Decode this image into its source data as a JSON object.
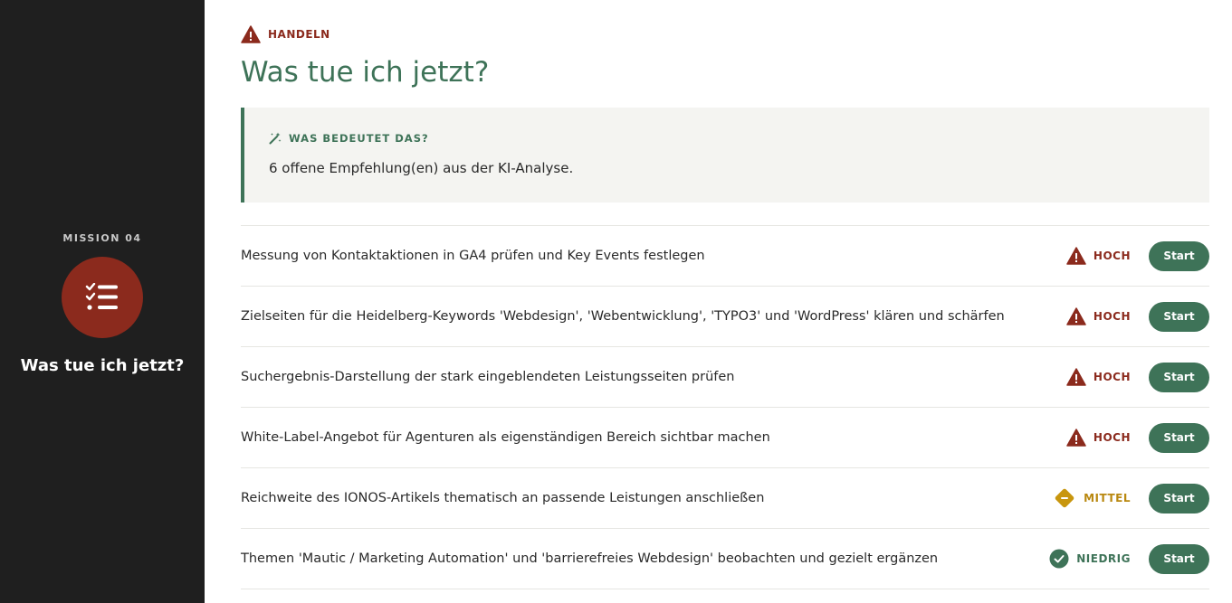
{
  "sidebar": {
    "mission_label": "MISSION 04",
    "icon": "checklist-icon",
    "title": "Was tue ich jetzt?"
  },
  "header": {
    "eyebrow": "HANDELN",
    "eyebrow_icon": "warning-icon",
    "title": "Was tue ich jetzt?"
  },
  "info": {
    "icon": "magic-wand-icon",
    "heading": "WAS BEDEUTET DAS?",
    "text": "6 offene Empfehlung(en) aus der KI-Analyse."
  },
  "recommendations": [
    {
      "text": "Messung von Kontaktaktionen in GA4 prüfen und Key Events festlegen",
      "priority": "HOCH",
      "priority_icon": "warning-icon",
      "button": "Start"
    },
    {
      "text": "Zielseiten für die Heidelberg-Keywords 'Webdesign', 'Webentwicklung', 'TYPO3' und 'WordPress' klären und schärfen",
      "priority": "HOCH",
      "priority_icon": "warning-icon",
      "button": "Start"
    },
    {
      "text": "Suchergebnis-Darstellung der stark eingeblendeten Leistungsseiten prüfen",
      "priority": "HOCH",
      "priority_icon": "warning-icon",
      "button": "Start"
    },
    {
      "text": "White-Label-Angebot für Agenturen als eigenständigen Bereich sichtbar machen",
      "priority": "HOCH",
      "priority_icon": "warning-icon",
      "button": "Start"
    },
    {
      "text": "Reichweite des IONOS-Artikels thematisch an passende Leistungen anschließen",
      "priority": "MITTEL",
      "priority_icon": "minus-diamond-icon",
      "button": "Start"
    },
    {
      "text": "Themen 'Mautic / Marketing Automation' und 'barrierefreies Webdesign' beobachten und gezielt ergänzen",
      "priority": "NIEDRIG",
      "priority_icon": "check-circle-icon",
      "button": "Start"
    }
  ],
  "colors": {
    "sidebar_bg": "#1f1f1f",
    "accent_green": "#3e7358",
    "accent_red": "#8b2a1d",
    "accent_amber": "#c8960e"
  }
}
